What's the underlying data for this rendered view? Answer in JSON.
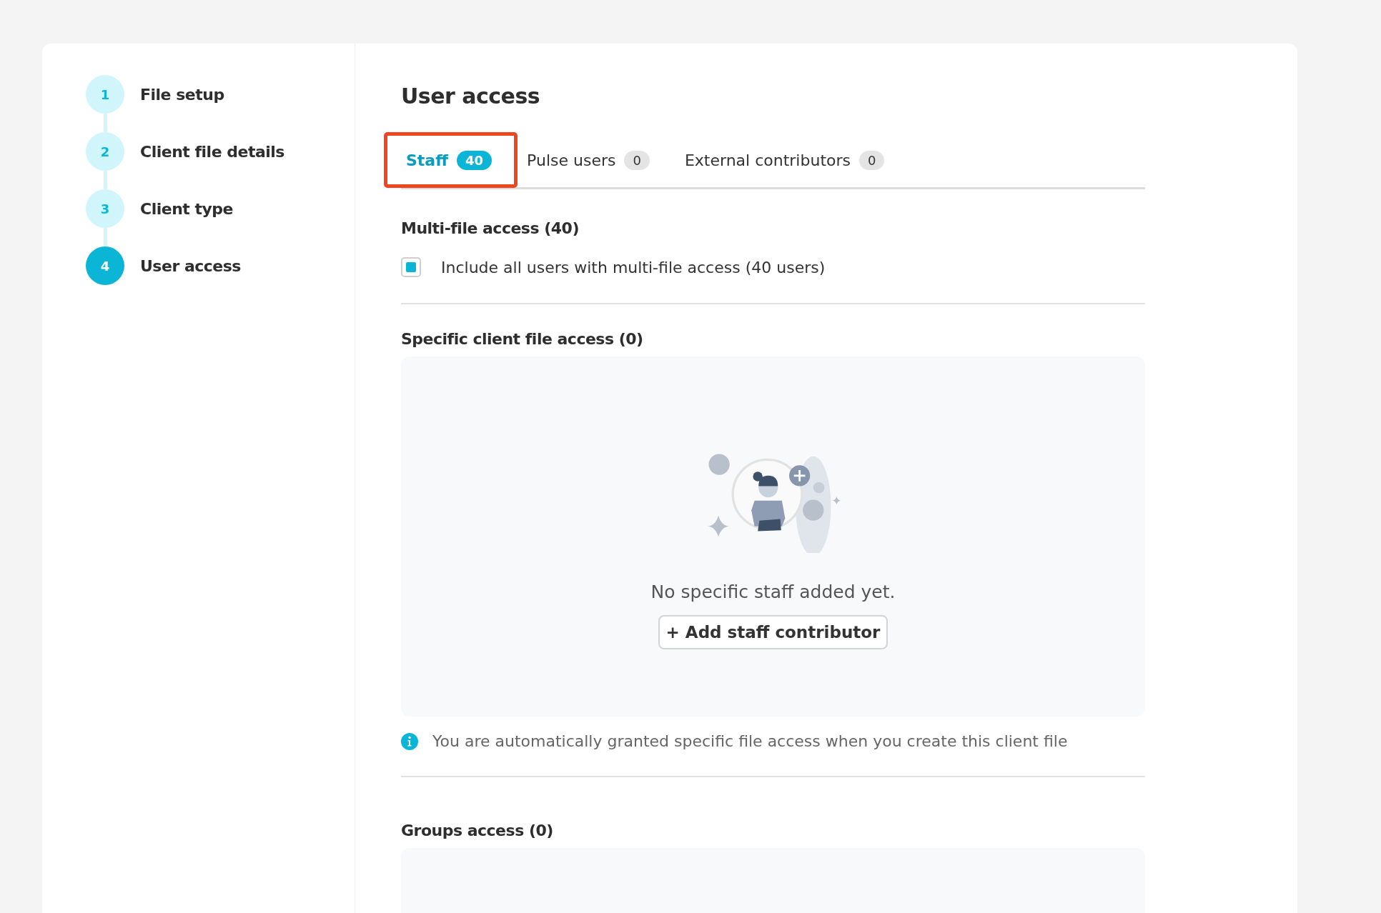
{
  "steps": [
    {
      "number": "1",
      "label": "File setup",
      "selected": false
    },
    {
      "number": "2",
      "label": "Client file details",
      "selected": false
    },
    {
      "number": "3",
      "label": "Client type",
      "selected": false
    },
    {
      "number": "4",
      "label": "User access",
      "selected": true
    }
  ],
  "title": "User access",
  "tabs": [
    {
      "label": "Staff",
      "count": "40",
      "selected": true,
      "highlighted": true
    },
    {
      "label": "Pulse users",
      "count": "0",
      "selected": false,
      "highlighted": false
    },
    {
      "label": "External contributors",
      "count": "0",
      "selected": false,
      "highlighted": false
    }
  ],
  "multi_file": {
    "heading": "Multi-file access (40)",
    "checkbox": {
      "label": "Include all users with multi-file access (40 users)",
      "checked": true
    }
  },
  "specific": {
    "heading": "Specific client file access (0)",
    "empty_text": "No specific staff added yet.",
    "button": "+ Add staff contributor",
    "info": "You are automatically granted specific file access when you create this client file"
  },
  "groups": {
    "heading": "Groups access (0)"
  }
}
